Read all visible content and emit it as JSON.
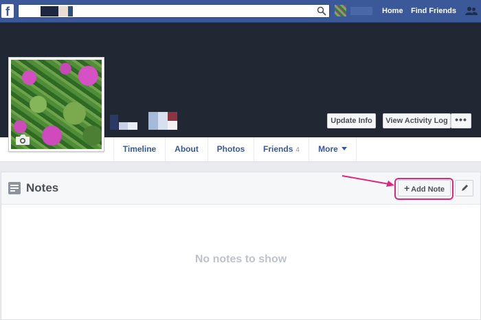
{
  "topbar": {
    "logo": "f",
    "search": {
      "value": "",
      "placeholder": ""
    },
    "nav": {
      "home": "Home",
      "find_friends": "Find Friends"
    }
  },
  "profile": {
    "buttons": {
      "update_info": "Update Info",
      "activity_log": "View Activity Log",
      "more": "•••"
    }
  },
  "tabs": {
    "timeline": "Timeline",
    "about": "About",
    "photos": "Photos",
    "friends": "Friends",
    "friends_count": "4",
    "more": "More"
  },
  "notes": {
    "title": "Notes",
    "add_note": "Add Note",
    "empty_message": "No notes to show"
  },
  "colors": {
    "brand": "#3b5998",
    "highlight": "#e0267c",
    "cover": "#222734"
  }
}
